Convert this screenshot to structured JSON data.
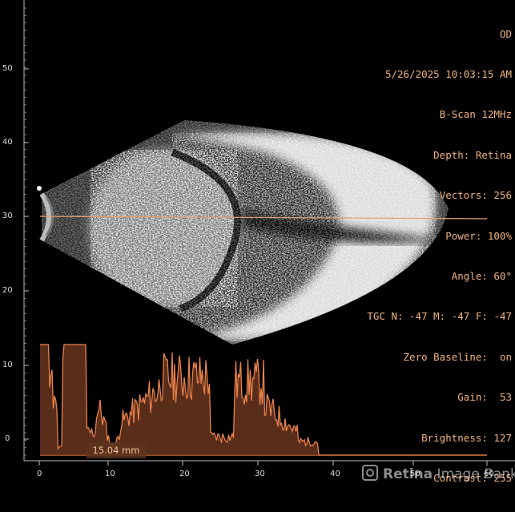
{
  "header": {
    "eye": "OD",
    "datetime": "5/26/2025 10:03:15 AM",
    "mode": "B-Scan 12MHz",
    "depth": "Depth: Retina",
    "vectors": "Vectors: 256",
    "power": "Power: 100%",
    "angle": "Angle: 60°",
    "tgc": "TGC N: -47 M: -47 F: -47",
    "zero_baseline": "Zero Baseline:  on",
    "gain": "Gain:  53",
    "brightness": "Brightness: 127",
    "contrast": "Contrast: 255"
  },
  "y_axis": {
    "labels": [
      "50",
      "40",
      "30",
      "20",
      "10",
      "0"
    ]
  },
  "x_axis": {
    "labels": [
      "0",
      "10",
      "20",
      "30",
      "40",
      "50",
      "60"
    ]
  },
  "measurement": {
    "label": "15.04 mm"
  },
  "watermark": {
    "brand": "Retina",
    "suffix": " Image Bank"
  },
  "colors": {
    "accent": "#e8824a",
    "text": "#f0b27c",
    "scanline": "#e8a070"
  }
}
